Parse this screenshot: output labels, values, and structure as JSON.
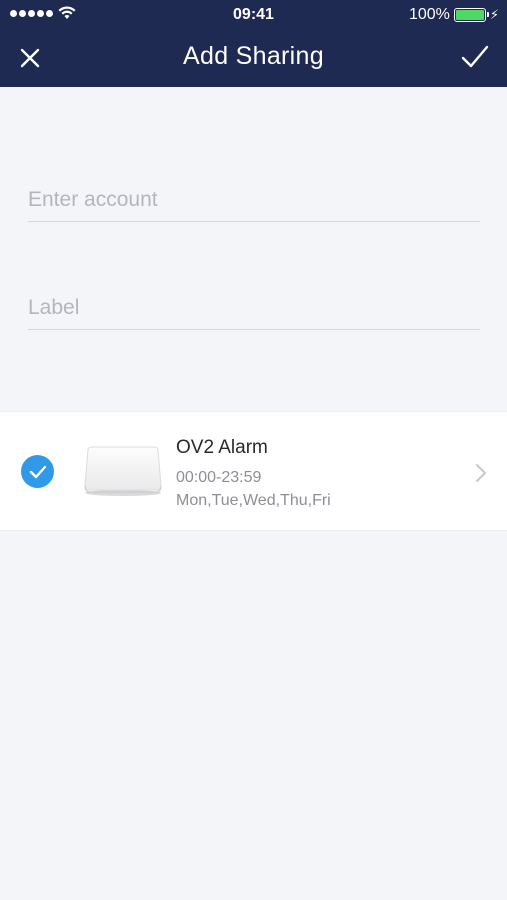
{
  "status_bar": {
    "time": "09:41",
    "battery_percent": "100%",
    "battery_level": 1.0,
    "signal_bars": 5
  },
  "nav": {
    "title": "Add Sharing",
    "close_icon": "close-icon",
    "confirm_icon": "checkmark-icon"
  },
  "form": {
    "account": {
      "value": "",
      "placeholder": "Enter account"
    },
    "label": {
      "value": "",
      "placeholder": "Label"
    }
  },
  "device": {
    "name": "OV2 Alarm",
    "time_range": "00:00-23:59",
    "days": "Mon,Tue,Wed,Thu,Fri",
    "selected": true
  },
  "colors": {
    "header_bg": "#1f2a52",
    "page_bg": "#f4f5f9",
    "accent": "#2f9ae8",
    "battery": "#4cd964"
  }
}
